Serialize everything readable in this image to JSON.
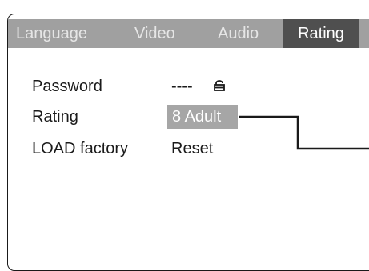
{
  "tabs": [
    {
      "label": "Language"
    },
    {
      "label": "Video"
    },
    {
      "label": "Audio"
    },
    {
      "label": "Rating",
      "active": true
    }
  ],
  "settings": [
    {
      "label": "Password",
      "value": "----",
      "icon": "lock-icon"
    },
    {
      "label": "Rating",
      "value": "8 Adult",
      "selected": true
    },
    {
      "label": "LOAD factory",
      "value": "Reset"
    }
  ],
  "colors": {
    "tabbar": "#a0a0a0",
    "active_tab": "#4f4f4f",
    "selection": "#a6a6a6",
    "text": "#1a1a1a"
  }
}
